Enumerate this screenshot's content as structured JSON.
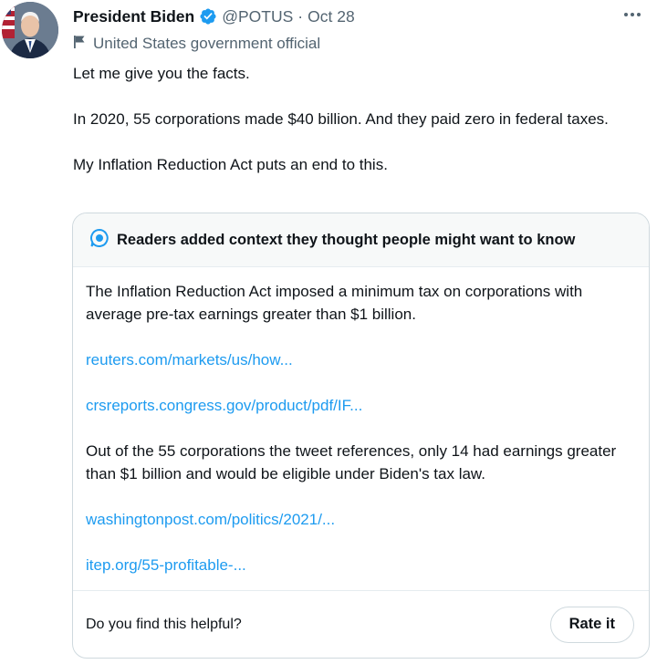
{
  "tweet": {
    "author_name": "President Biden",
    "handle": "@POTUS",
    "separator": "·",
    "date": "Oct 28",
    "account_label": "United States government official",
    "lines": [
      "Let me give you the facts.",
      "In 2020, 55 corporations made $40 billion. And they paid zero in federal taxes.",
      "My Inflation Reduction Act puts an end to this."
    ]
  },
  "note": {
    "header": "Readers added context they thought people might want to know",
    "paragraph_1": "The Inflation Reduction Act imposed a minimum tax on corporations with average pre-tax earnings greater than $1 billion.",
    "link_1": "reuters.com/markets/us/how...",
    "link_2": "crsreports.congress.gov/product/pdf/IF...",
    "paragraph_2": "Out of the 55 corporations the tweet references, only 14 had earnings greater than $1 billion and would be eligible under Biden's tax law.",
    "link_3": "washingtonpost.com/politics/2021/...",
    "link_4": "itep.org/55-profitable-...",
    "footer_question": "Do you find this helpful?",
    "rate_button": "Rate it"
  },
  "icons": {
    "verified": "verified-badge-icon",
    "flag": "flag-icon",
    "more": "more-options-icon",
    "note": "community-notes-icon"
  },
  "colors": {
    "accent": "#1d9bf0",
    "muted_text": "#536471",
    "border": "#cfd9de"
  }
}
